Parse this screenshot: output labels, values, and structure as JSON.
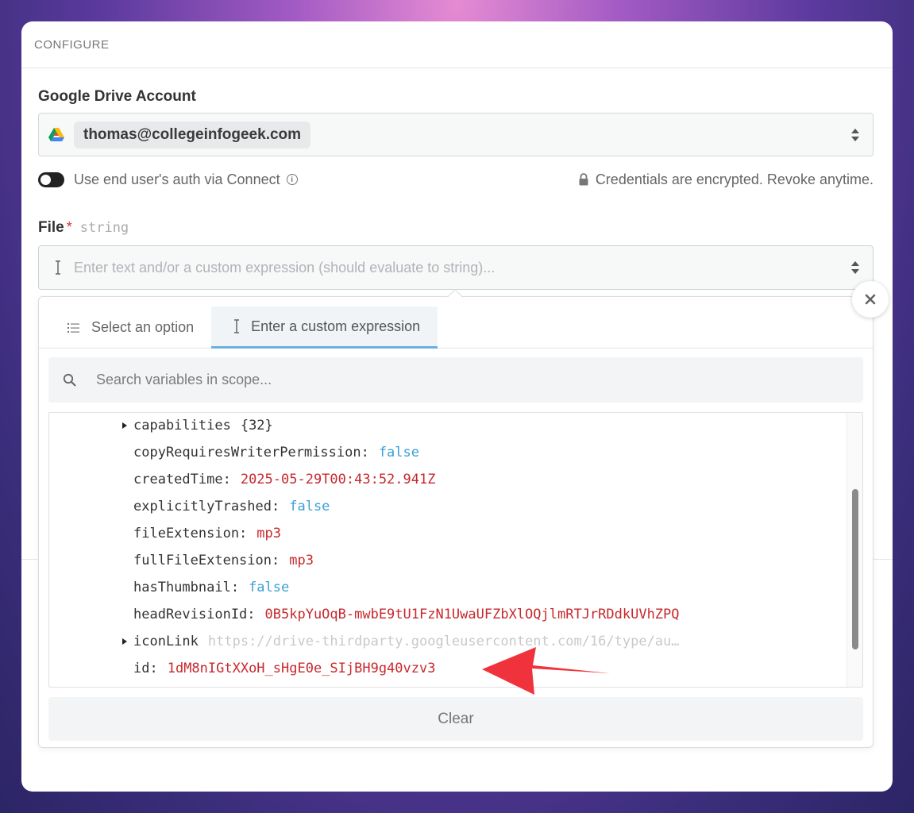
{
  "header": {
    "title": "CONFIGURE"
  },
  "account": {
    "label": "Google Drive Account",
    "email": "thomas@collegeinfogeek.com"
  },
  "auth_toggle": {
    "label": "Use end user's auth via Connect",
    "on": false
  },
  "credentials_note": "Credentials are encrypted. Revoke anytime.",
  "file_field": {
    "label": "File",
    "required_mark": "*",
    "type": "string",
    "placeholder": "Enter text and/or a custom expression (should evaluate to string)..."
  },
  "tabs": [
    {
      "label": "Select an option",
      "active": false
    },
    {
      "label": "Enter a custom expression",
      "active": true
    }
  ],
  "search": {
    "placeholder": "Search variables in scope..."
  },
  "tree": [
    {
      "key": "capabilities",
      "value": "{32}",
      "kind": "plain",
      "expandable": true
    },
    {
      "key": "copyRequiresWriterPermission:",
      "value": "false",
      "kind": "bool",
      "expandable": false
    },
    {
      "key": "createdTime:",
      "value": "2025-05-29T00:43:52.941Z",
      "kind": "str",
      "expandable": false
    },
    {
      "key": "explicitlyTrashed:",
      "value": "false",
      "kind": "bool",
      "expandable": false
    },
    {
      "key": "fileExtension:",
      "value": "mp3",
      "kind": "str",
      "expandable": false
    },
    {
      "key": "fullFileExtension:",
      "value": "mp3",
      "kind": "str",
      "expandable": false
    },
    {
      "key": "hasThumbnail:",
      "value": "false",
      "kind": "bool",
      "expandable": false
    },
    {
      "key": "headRevisionId:",
      "value": "0B5kpYuOqB-mwbE9tU1FzN1UwaUFZbXlOQjlmRTJrRDdkUVhZPQ",
      "kind": "str",
      "expandable": false
    },
    {
      "key": "iconLink",
      "value": "https://drive-thirdparty.googleusercontent.com/16/type/au…",
      "kind": "muted",
      "expandable": true
    },
    {
      "key": "id:",
      "value": "1dM8nIGtXXoH_sHgE0e_SIjBH9g40vzv3",
      "kind": "str",
      "expandable": false
    }
  ],
  "clear_label": "Clear",
  "colors": {
    "accent": "#6ab0df",
    "string": "#c8282c",
    "boolean": "#3aa0d6",
    "arrow": "#f0323c"
  }
}
